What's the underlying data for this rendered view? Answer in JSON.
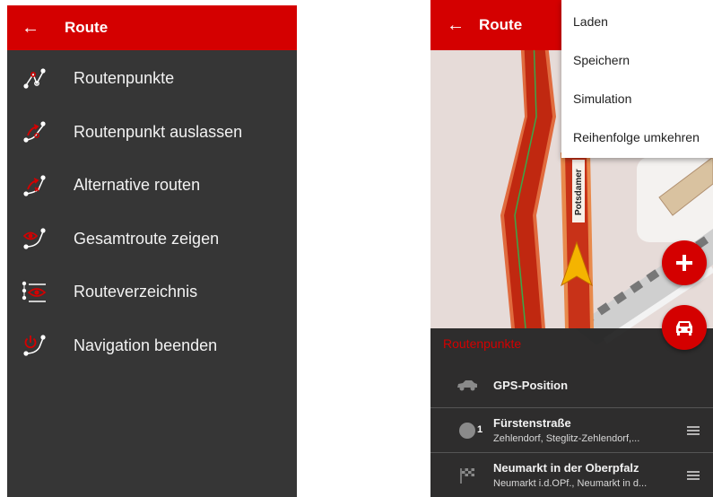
{
  "left": {
    "header": {
      "title": "Route"
    },
    "menu": [
      {
        "label": "Routenpunkte",
        "icon": "route-points-icon"
      },
      {
        "label": "Routenpunkt auslassen",
        "icon": "skip-route-point-icon"
      },
      {
        "label": "Alternative routen",
        "icon": "alternative-routes-icon"
      },
      {
        "label": "Gesamtroute zeigen",
        "icon": "show-route-icon"
      },
      {
        "label": "Routeverzeichnis",
        "icon": "route-directory-icon"
      },
      {
        "label": "Navigation beenden",
        "icon": "stop-navigation-icon"
      }
    ]
  },
  "right": {
    "header": {
      "title": "Route"
    },
    "popup_menu": [
      "Laden",
      "Speichern",
      "Simulation",
      "Reihenfolge umkehren"
    ],
    "map": {
      "street_label": "Potsdamer"
    },
    "panel": {
      "title": "Routenpunkte",
      "gps": {
        "label": "GPS-Position"
      },
      "points": [
        {
          "number": "1",
          "name": "Fürstenstraße",
          "address": "Zehlendorf, Steglitz-Zehlendorf,..."
        },
        {
          "name": "Neumarkt in der Oberpfalz",
          "address": "Neumarkt i.d.OPf., Neumarkt in d..."
        }
      ]
    }
  },
  "colors": {
    "accent": "#d40000",
    "menu_bg": "#363636",
    "text": "#f2f2f2"
  }
}
